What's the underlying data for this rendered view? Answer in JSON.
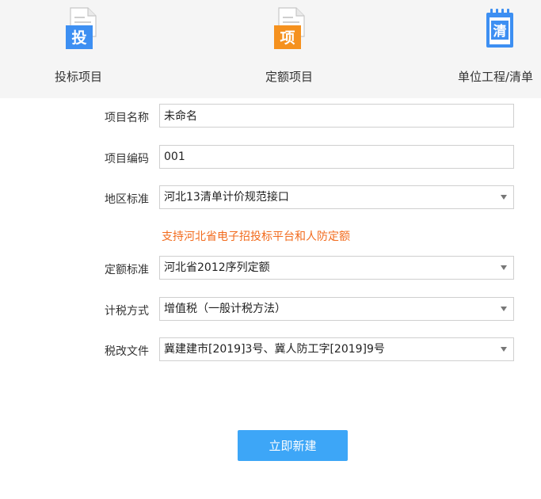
{
  "tabs": [
    {
      "label": "投标项目",
      "icon_char": "投",
      "icon": "bid-document-icon",
      "color": "#3d8ff2"
    },
    {
      "label": "定额项目",
      "icon_char": "项",
      "icon": "quota-document-icon",
      "color": "#f5911e"
    },
    {
      "label": "单位工程/清单",
      "icon_char": "清",
      "icon": "bill-notepad-icon",
      "color": "#3d8ff2"
    }
  ],
  "form": {
    "project_name": {
      "label": "项目名称",
      "value": "未命名"
    },
    "project_code": {
      "label": "项目编码",
      "value": "001"
    },
    "region_standard": {
      "label": "地区标准",
      "value": "河北13清单计价规范接口"
    },
    "hint": "支持河北省电子招投标平台和人防定额",
    "quota_standard": {
      "label": "定额标准",
      "value": "河北省2012序列定额"
    },
    "tax_method": {
      "label": "计税方式",
      "value": "增值税（一般计税方法）"
    },
    "tax_reform_file": {
      "label": "税改文件",
      "value": "冀建建市[2019]3号、冀人防工字[2019]9号"
    }
  },
  "create_button": "立即新建",
  "colors": {
    "accent": "#3da6f7",
    "hint": "#f26b1d",
    "topbar_bg": "#f5f5f5"
  }
}
